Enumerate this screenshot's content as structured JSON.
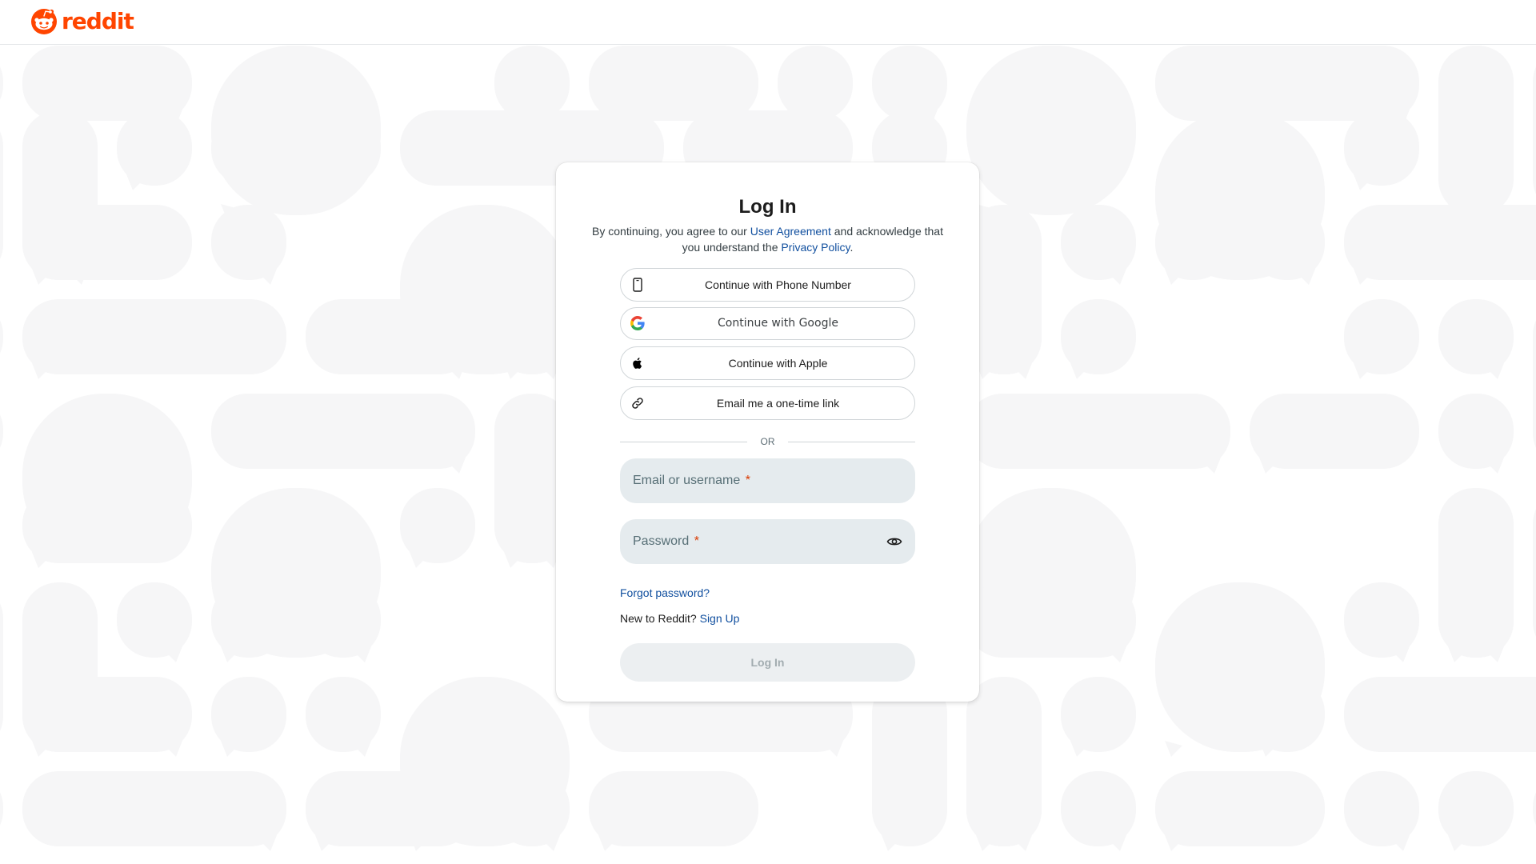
{
  "brand": {
    "wordmark": "reddit",
    "color": "#ff4500"
  },
  "modal": {
    "title": "Log In",
    "legal": {
      "prefix": "By continuing, you agree to our",
      "user_agreement": "User Agreement",
      "middle": "and acknowledge that you understand the",
      "privacy_policy": "Privacy Policy",
      "suffix": "."
    },
    "sso_buttons": [
      {
        "label": "Continue with Phone Number",
        "icon": "phone-icon"
      },
      {
        "label": "Continue with Google",
        "icon": "google-icon"
      },
      {
        "label": "Continue with Apple",
        "icon": "apple-icon"
      },
      {
        "label": "Email me a one-time link",
        "icon": "link-icon"
      }
    ],
    "divider": "OR",
    "fields": {
      "username": {
        "placeholder": "Email or username",
        "required_mark": "*",
        "value": ""
      },
      "password": {
        "placeholder": "Password",
        "required_mark": "*",
        "value": "",
        "toggle_icon": "eye-icon"
      }
    },
    "forgot_password": "Forgot password?",
    "signup": {
      "prompt": "New to Reddit?",
      "link": "Sign Up"
    },
    "submit": {
      "label": "Log In",
      "enabled": false
    }
  },
  "colors": {
    "link": "#0f4e9e",
    "required": "#d93900",
    "field_bg": "#e5ebee",
    "pattern": "#f6f6f7"
  }
}
